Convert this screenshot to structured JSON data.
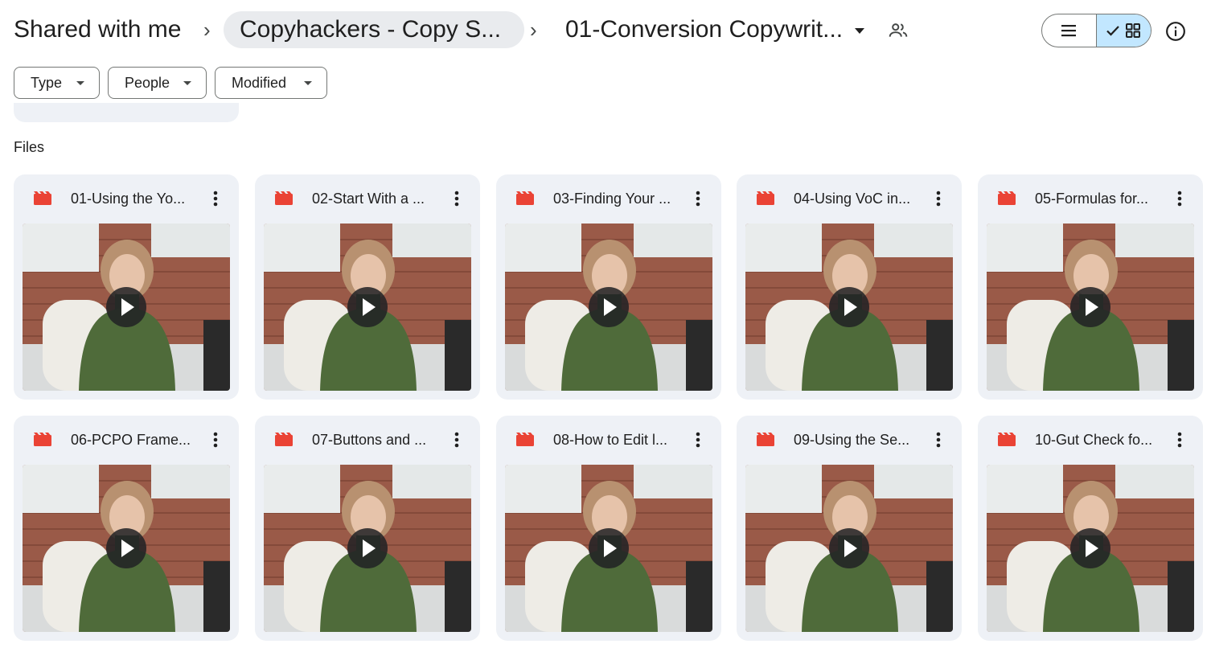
{
  "breadcrumb": {
    "root": "Shared with me",
    "parent": "Copyhackers - Copy S...",
    "current": "01-Conversion Copywrit..."
  },
  "icons": {
    "separator": "chevron-right-icon",
    "share": "people-icon",
    "list_view": "list-view-icon",
    "grid_view": "grid-view-icon",
    "checkmark": "check-icon",
    "info": "info-icon",
    "file_type": "video-file-icon",
    "more": "more-vert-icon",
    "play": "play-icon"
  },
  "view": {
    "selected": "grid"
  },
  "filters": {
    "type": "Type",
    "people": "People",
    "modified": "Modified"
  },
  "section": {
    "files_label": "Files"
  },
  "colors": {
    "video_icon": "#ea4335",
    "card_bg": "#eef1f6",
    "selected_toggle": "#c2e7ff"
  },
  "files": [
    {
      "name": "01-Using the Yo..."
    },
    {
      "name": "02-Start With a ..."
    },
    {
      "name": "03-Finding Your ..."
    },
    {
      "name": "04-Using VoC in..."
    },
    {
      "name": "05-Formulas for..."
    },
    {
      "name": "06-PCPO Frame..."
    },
    {
      "name": "07-Buttons and ..."
    },
    {
      "name": "08-How to Edit l..."
    },
    {
      "name": "09-Using the Se..."
    },
    {
      "name": "10-Gut Check fo..."
    }
  ]
}
